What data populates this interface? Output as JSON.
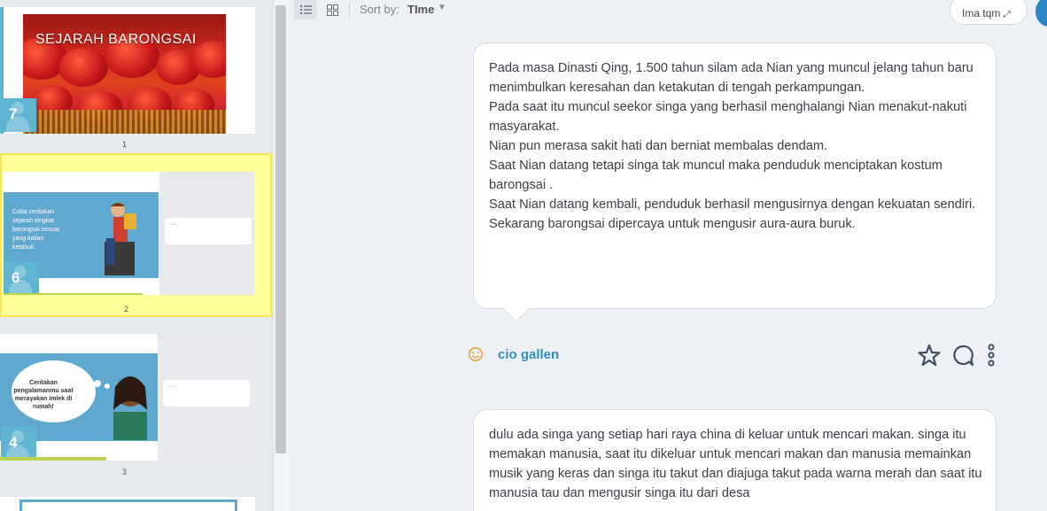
{
  "sidebar": {
    "slides": [
      {
        "title": "SEJARAH BARONGSAI",
        "badge": "7",
        "number": "1"
      },
      {
        "text": "Coba ceritakan\nsejarah singkat\nbarongsai sesuai\nyang kalian\nketahui!",
        "badge": "6",
        "number": "2"
      },
      {
        "text": "Ceritakan pengalamanmu saat merayakan imlek di rumah!",
        "badge": "4",
        "number": "3"
      }
    ]
  },
  "toolbar": {
    "list_view_icon": "list-icon",
    "grid_view_icon": "grid-icon",
    "sort_label": "Sort by:",
    "sort_value": "TIme",
    "user_label": "Ima tqm"
  },
  "posts": [
    {
      "text": "Pada masa Dinasti Qing, 1.500 tahun silam ada Nian yang muncul jelang tahun baru menimbulkan keresahan dan ketakutan di tengah perkampungan.\nPada saat itu muncul seekor singa yang berhasil menghalangi Nian menakut-nakuti masyarakat.\nNian pun merasa sakit hati dan berniat membalas dendam.\nSaat Nian datang tetapi singa tak muncul maka penduduk menciptakan kostum barongsai .\nSaat Nian datang kembali, penduduk berhasil mengusirnya dengan kekuatan sendiri.\nSekarang barongsai dipercaya untuk mengusir aura-aura buruk.",
      "author": "cio gallen"
    },
    {
      "text": "dulu ada singa yang setiap hari raya china di keluar untuk mencari makan. singa itu memakan manusia,  saat itu dikeluar untuk mencari makan dan manusia memainkan musik yang keras dan singa itu takut dan diajuga takut pada warna merah dan saat itu manusia tau dan mengusir singa itu dari desa"
    }
  ],
  "colors": {
    "accent": "#5fb4d1",
    "highlight": "#ffff99",
    "author": "#2f8fc0",
    "icon": "#3d4f63"
  }
}
